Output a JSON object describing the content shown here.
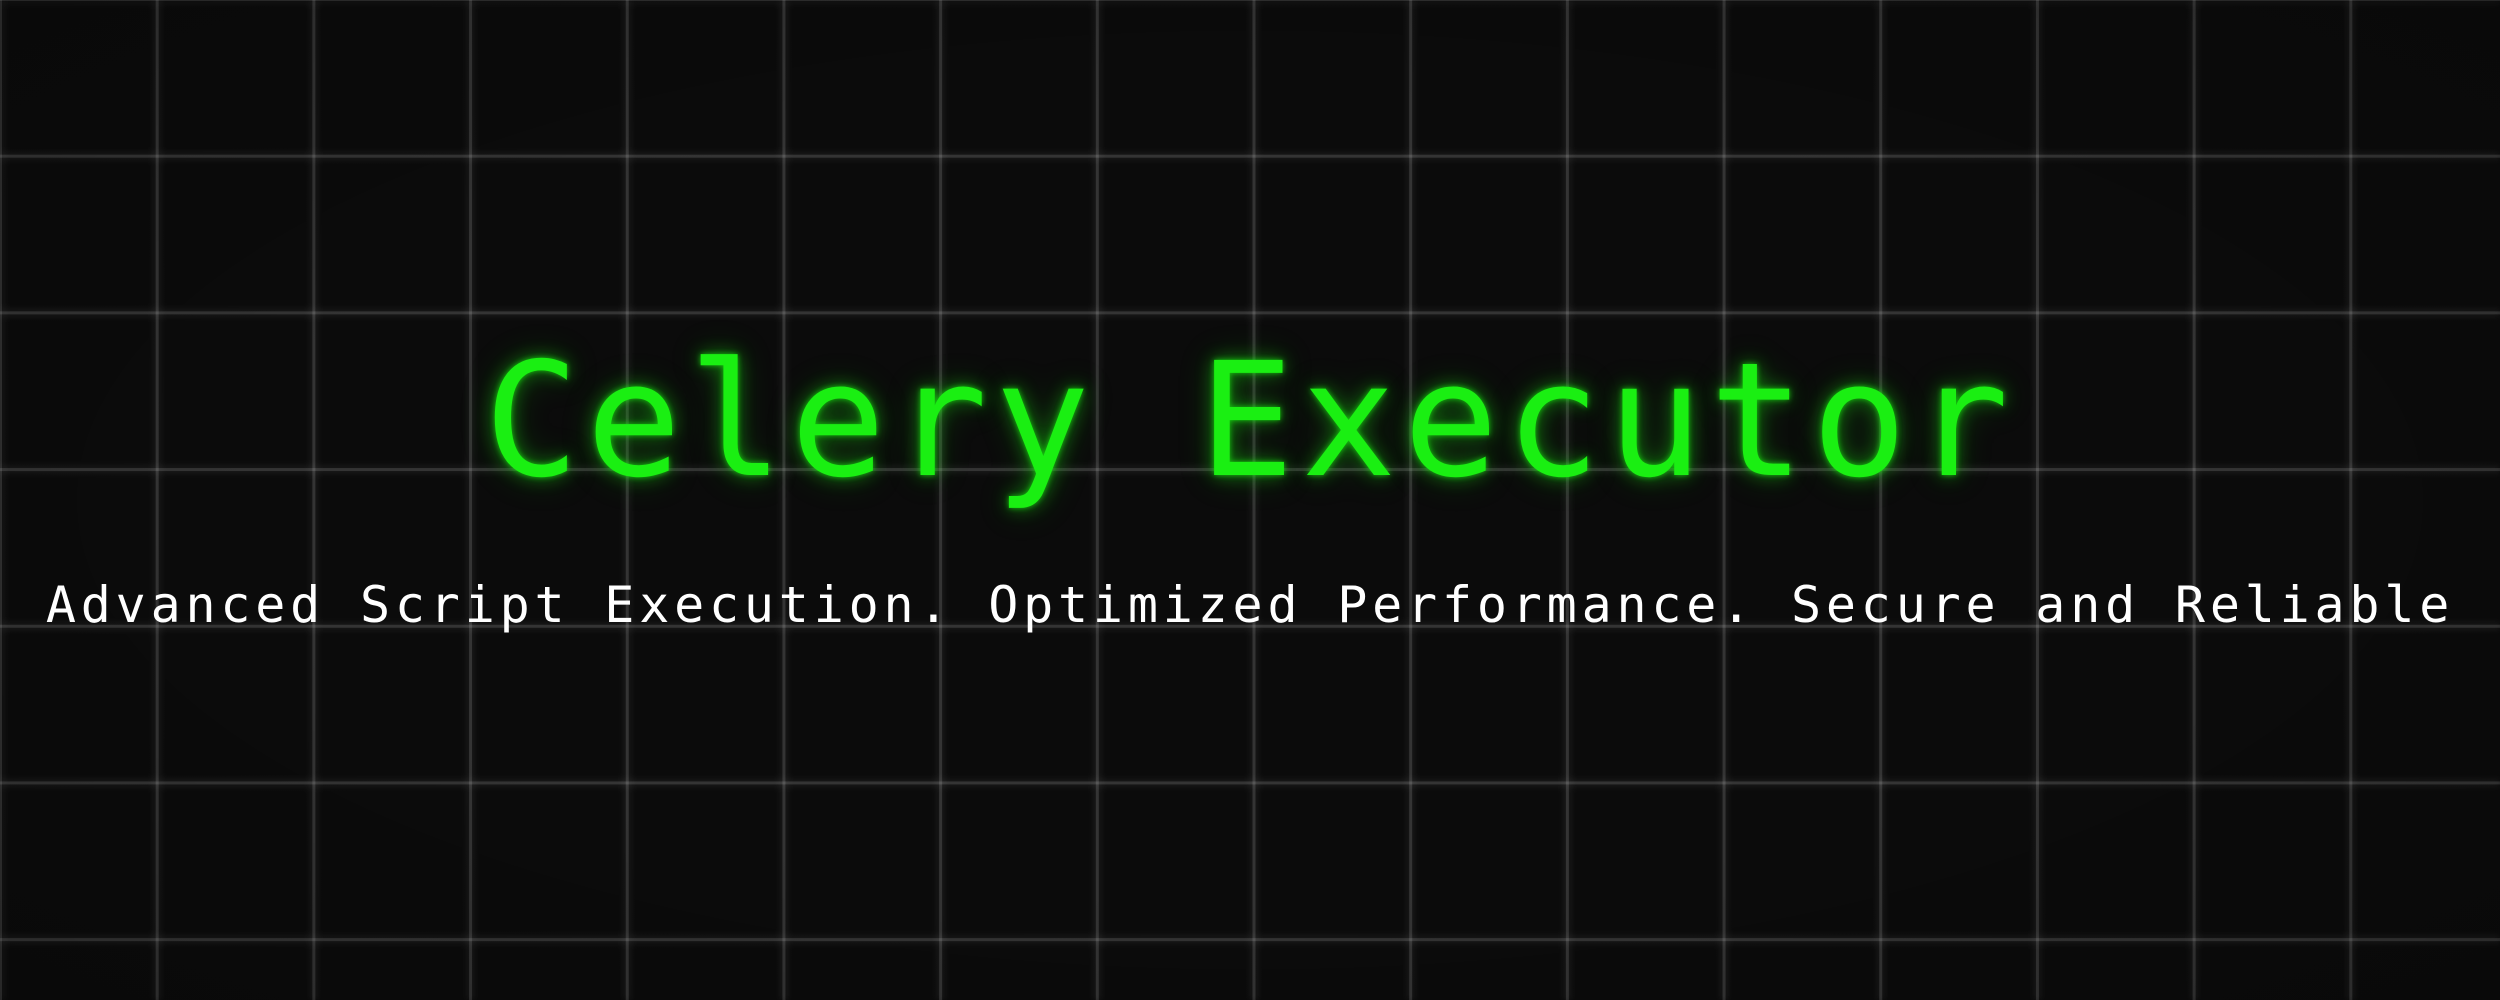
{
  "banner": {
    "title": "Celery Executor",
    "subtitle": "Advanced Script Execution. Optimized Performance. Secure and Reliable"
  },
  "colors": {
    "background": "#0b0b0b",
    "grid": "#2a2a2a",
    "title": "#1aef12",
    "subtitle": "#ffffff"
  }
}
